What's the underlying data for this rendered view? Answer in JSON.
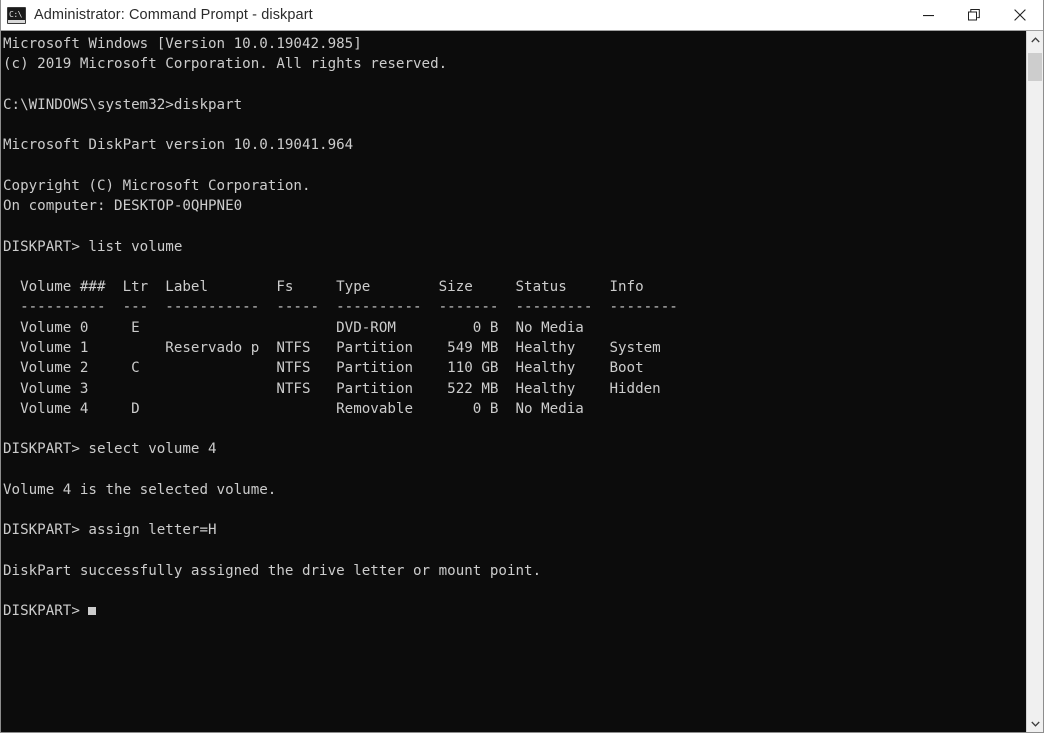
{
  "window": {
    "title": "Administrator: Command Prompt - diskpart",
    "icon_name": "cmd-icon",
    "icon_glyph": "C:\\",
    "background_color": "#0c0c0c",
    "titlebar_color": "#ffffff",
    "text_color": "#cccccc"
  },
  "titlebar_buttons": {
    "minimize_label": "Minimize",
    "restore_label": "Restore Down",
    "close_label": "Close"
  },
  "scrollbar": {
    "up_arrow_label": "Scroll up",
    "down_arrow_label": "Scroll down",
    "thumb_label": "Scroll thumb"
  },
  "console": {
    "prompt": "DISKPART>",
    "cursor_visible": true,
    "lines": [
      "Microsoft Windows [Version 10.0.19042.985]",
      "(c) 2019 Microsoft Corporation. All rights reserved.",
      "",
      "C:\\WINDOWS\\system32>diskpart",
      "",
      "Microsoft DiskPart version 10.0.19041.964",
      "",
      "Copyright (C) Microsoft Corporation.",
      "On computer: DESKTOP-0QHPNE0",
      "",
      "DISKPART> list volume",
      "",
      "  Volume ###  Ltr  Label        Fs     Type        Size     Status     Info",
      "  ----------  ---  -----------  -----  ----------  -------  ---------  --------",
      "  Volume 0     E                       DVD-ROM         0 B  No Media",
      "  Volume 1         Reservado p  NTFS   Partition    549 MB  Healthy    System",
      "  Volume 2     C                NTFS   Partition    110 GB  Healthy    Boot",
      "  Volume 3                      NTFS   Partition    522 MB  Healthy    Hidden",
      "  Volume 4     D                       Removable       0 B  No Media",
      "",
      "DISKPART> select volume 4",
      "",
      "Volume 4 is the selected volume.",
      "",
      "DISKPART> assign letter=H",
      "",
      "DiskPart successfully assigned the drive letter or mount point.",
      ""
    ],
    "final_prompt": "DISKPART> ",
    "commands_entered": [
      "diskpart",
      "list volume",
      "select volume 4",
      "assign letter=H"
    ],
    "volume_table": {
      "headers": [
        "Volume ###",
        "Ltr",
        "Label",
        "Fs",
        "Type",
        "Size",
        "Status",
        "Info"
      ],
      "rows": [
        {
          "volume": "Volume 0",
          "ltr": "E",
          "label": "",
          "fs": "",
          "type": "DVD-ROM",
          "size": "0 B",
          "status": "No Media",
          "info": ""
        },
        {
          "volume": "Volume 1",
          "ltr": "",
          "label": "Reservado p",
          "fs": "NTFS",
          "type": "Partition",
          "size": "549 MB",
          "status": "Healthy",
          "info": "System"
        },
        {
          "volume": "Volume 2",
          "ltr": "C",
          "label": "",
          "fs": "NTFS",
          "type": "Partition",
          "size": "110 GB",
          "status": "Healthy",
          "info": "Boot"
        },
        {
          "volume": "Volume 3",
          "ltr": "",
          "label": "",
          "fs": "NTFS",
          "type": "Partition",
          "size": "522 MB",
          "status": "Healthy",
          "info": "Hidden"
        },
        {
          "volume": "Volume 4",
          "ltr": "D",
          "label": "",
          "fs": "",
          "type": "Removable",
          "size": "0 B",
          "status": "No Media",
          "info": ""
        }
      ]
    },
    "messages": {
      "windows_version": "Microsoft Windows [Version 10.0.19042.985]",
      "copyright_line": "(c) 2019 Microsoft Corporation. All rights reserved.",
      "system32_prompt": "C:\\WINDOWS\\system32>diskpart",
      "diskpart_version": "Microsoft DiskPart version 10.0.19041.964",
      "diskpart_copyright": "Copyright (C) Microsoft Corporation.",
      "on_computer": "On computer: DESKTOP-0QHPNE0",
      "selected_volume": "Volume 4 is the selected volume.",
      "assign_success": "DiskPart successfully assigned the drive letter or mount point."
    }
  }
}
